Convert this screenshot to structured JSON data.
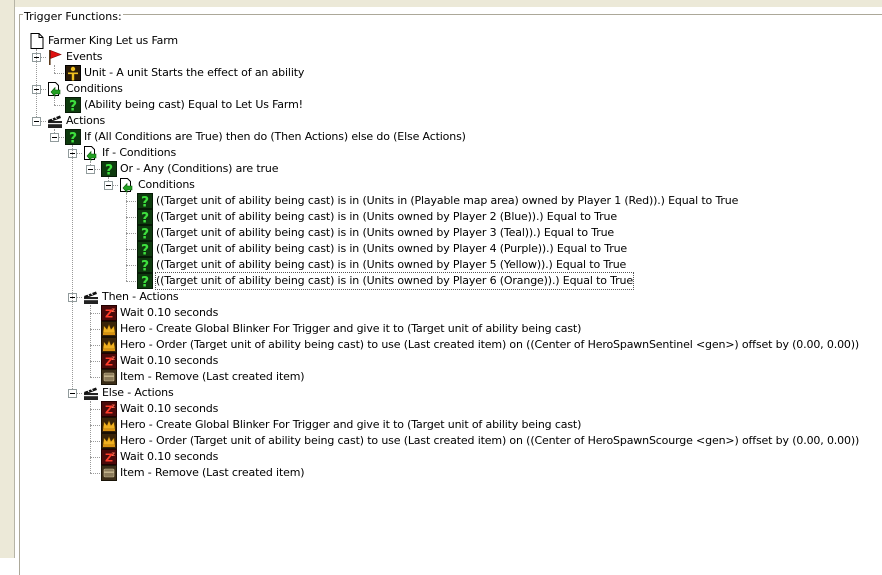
{
  "panel": {
    "title": "Trigger Functions:"
  },
  "tree": [
    {
      "label": "Farmer King Let us Farm",
      "icon": "document-icon",
      "depth": 0,
      "expander": false
    },
    {
      "label": "Events",
      "icon": "red-flag-icon",
      "depth": 1,
      "expander": true
    },
    {
      "label": "Unit - A unit Starts the effect of an ability",
      "icon": "unit-event-icon",
      "depth": 2,
      "expander": false
    },
    {
      "label": "Conditions",
      "icon": "conditions-icon",
      "depth": 1,
      "expander": true
    },
    {
      "label": "(Ability being cast) Equal to Let Us Farm!",
      "icon": "condition-question-icon",
      "depth": 2,
      "expander": false
    },
    {
      "label": "Actions",
      "icon": "actions-icon",
      "depth": 1,
      "expander": true
    },
    {
      "label": "If (All Conditions are True) then do (Then Actions) else do (Else Actions)",
      "icon": "condition-question-icon",
      "depth": 2,
      "expander": true
    },
    {
      "label": "If - Conditions",
      "icon": "conditions-icon",
      "depth": 3,
      "expander": true
    },
    {
      "label": "Or - Any (Conditions) are true",
      "icon": "condition-question-icon",
      "depth": 4,
      "expander": true
    },
    {
      "label": "Conditions",
      "icon": "conditions-icon",
      "depth": 5,
      "expander": true
    },
    {
      "label": "((Target unit of ability being cast) is in (Units in (Playable map area) owned by Player 1 (Red)).) Equal to True",
      "icon": "condition-question-icon",
      "depth": 6,
      "expander": false
    },
    {
      "label": "((Target unit of ability being cast) is in (Units owned by Player 2 (Blue)).) Equal to True",
      "icon": "condition-question-icon",
      "depth": 6,
      "expander": false
    },
    {
      "label": "((Target unit of ability being cast) is in (Units owned by Player 3 (Teal)).) Equal to True",
      "icon": "condition-question-icon",
      "depth": 6,
      "expander": false
    },
    {
      "label": "((Target unit of ability being cast) is in (Units owned by Player 4 (Purple)).) Equal to True",
      "icon": "condition-question-icon",
      "depth": 6,
      "expander": false
    },
    {
      "label": "((Target unit of ability being cast) is in (Units owned by Player 5 (Yellow)).) Equal to True",
      "icon": "condition-question-icon",
      "depth": 6,
      "expander": false
    },
    {
      "label": "((Target unit of ability being cast) is in (Units owned by Player 6 (Orange)).) Equal to True",
      "icon": "condition-question-icon",
      "depth": 6,
      "expander": false,
      "selected": true
    },
    {
      "label": "Then - Actions",
      "icon": "actions-icon",
      "depth": 3,
      "expander": true
    },
    {
      "label": "Wait 0.10 seconds",
      "icon": "wait-icon",
      "depth": 4,
      "expander": false
    },
    {
      "label": "Hero - Create Global Blinker For Trigger and give it to (Target unit of ability being cast)",
      "icon": "hero-icon",
      "depth": 4,
      "expander": false
    },
    {
      "label": "Hero - Order (Target unit of ability being cast) to use (Last created item) on ((Center of HeroSpawnSentinel <gen>) offset by (0.00, 0.00))",
      "icon": "hero-icon",
      "depth": 4,
      "expander": false
    },
    {
      "label": "Wait 0.10 seconds",
      "icon": "wait-icon",
      "depth": 4,
      "expander": false
    },
    {
      "label": "Item - Remove (Last created item)",
      "icon": "item-icon",
      "depth": 4,
      "expander": false
    },
    {
      "label": "Else - Actions",
      "icon": "actions-icon",
      "depth": 3,
      "expander": true
    },
    {
      "label": "Wait 0.10 seconds",
      "icon": "wait-icon",
      "depth": 4,
      "expander": false
    },
    {
      "label": "Hero - Create Global Blinker For Trigger and give it to (Target unit of ability being cast)",
      "icon": "hero-icon",
      "depth": 4,
      "expander": false
    },
    {
      "label": "Hero - Order (Target unit of ability being cast) to use (Last created item) on ((Center of HeroSpawnScourge <gen>) offset by (0.00, 0.00))",
      "icon": "hero-icon",
      "depth": 4,
      "expander": false
    },
    {
      "label": "Wait 0.10 seconds",
      "icon": "wait-icon",
      "depth": 4,
      "expander": false
    },
    {
      "label": "Item - Remove (Last created item)",
      "icon": "item-icon",
      "depth": 4,
      "expander": false
    }
  ]
}
